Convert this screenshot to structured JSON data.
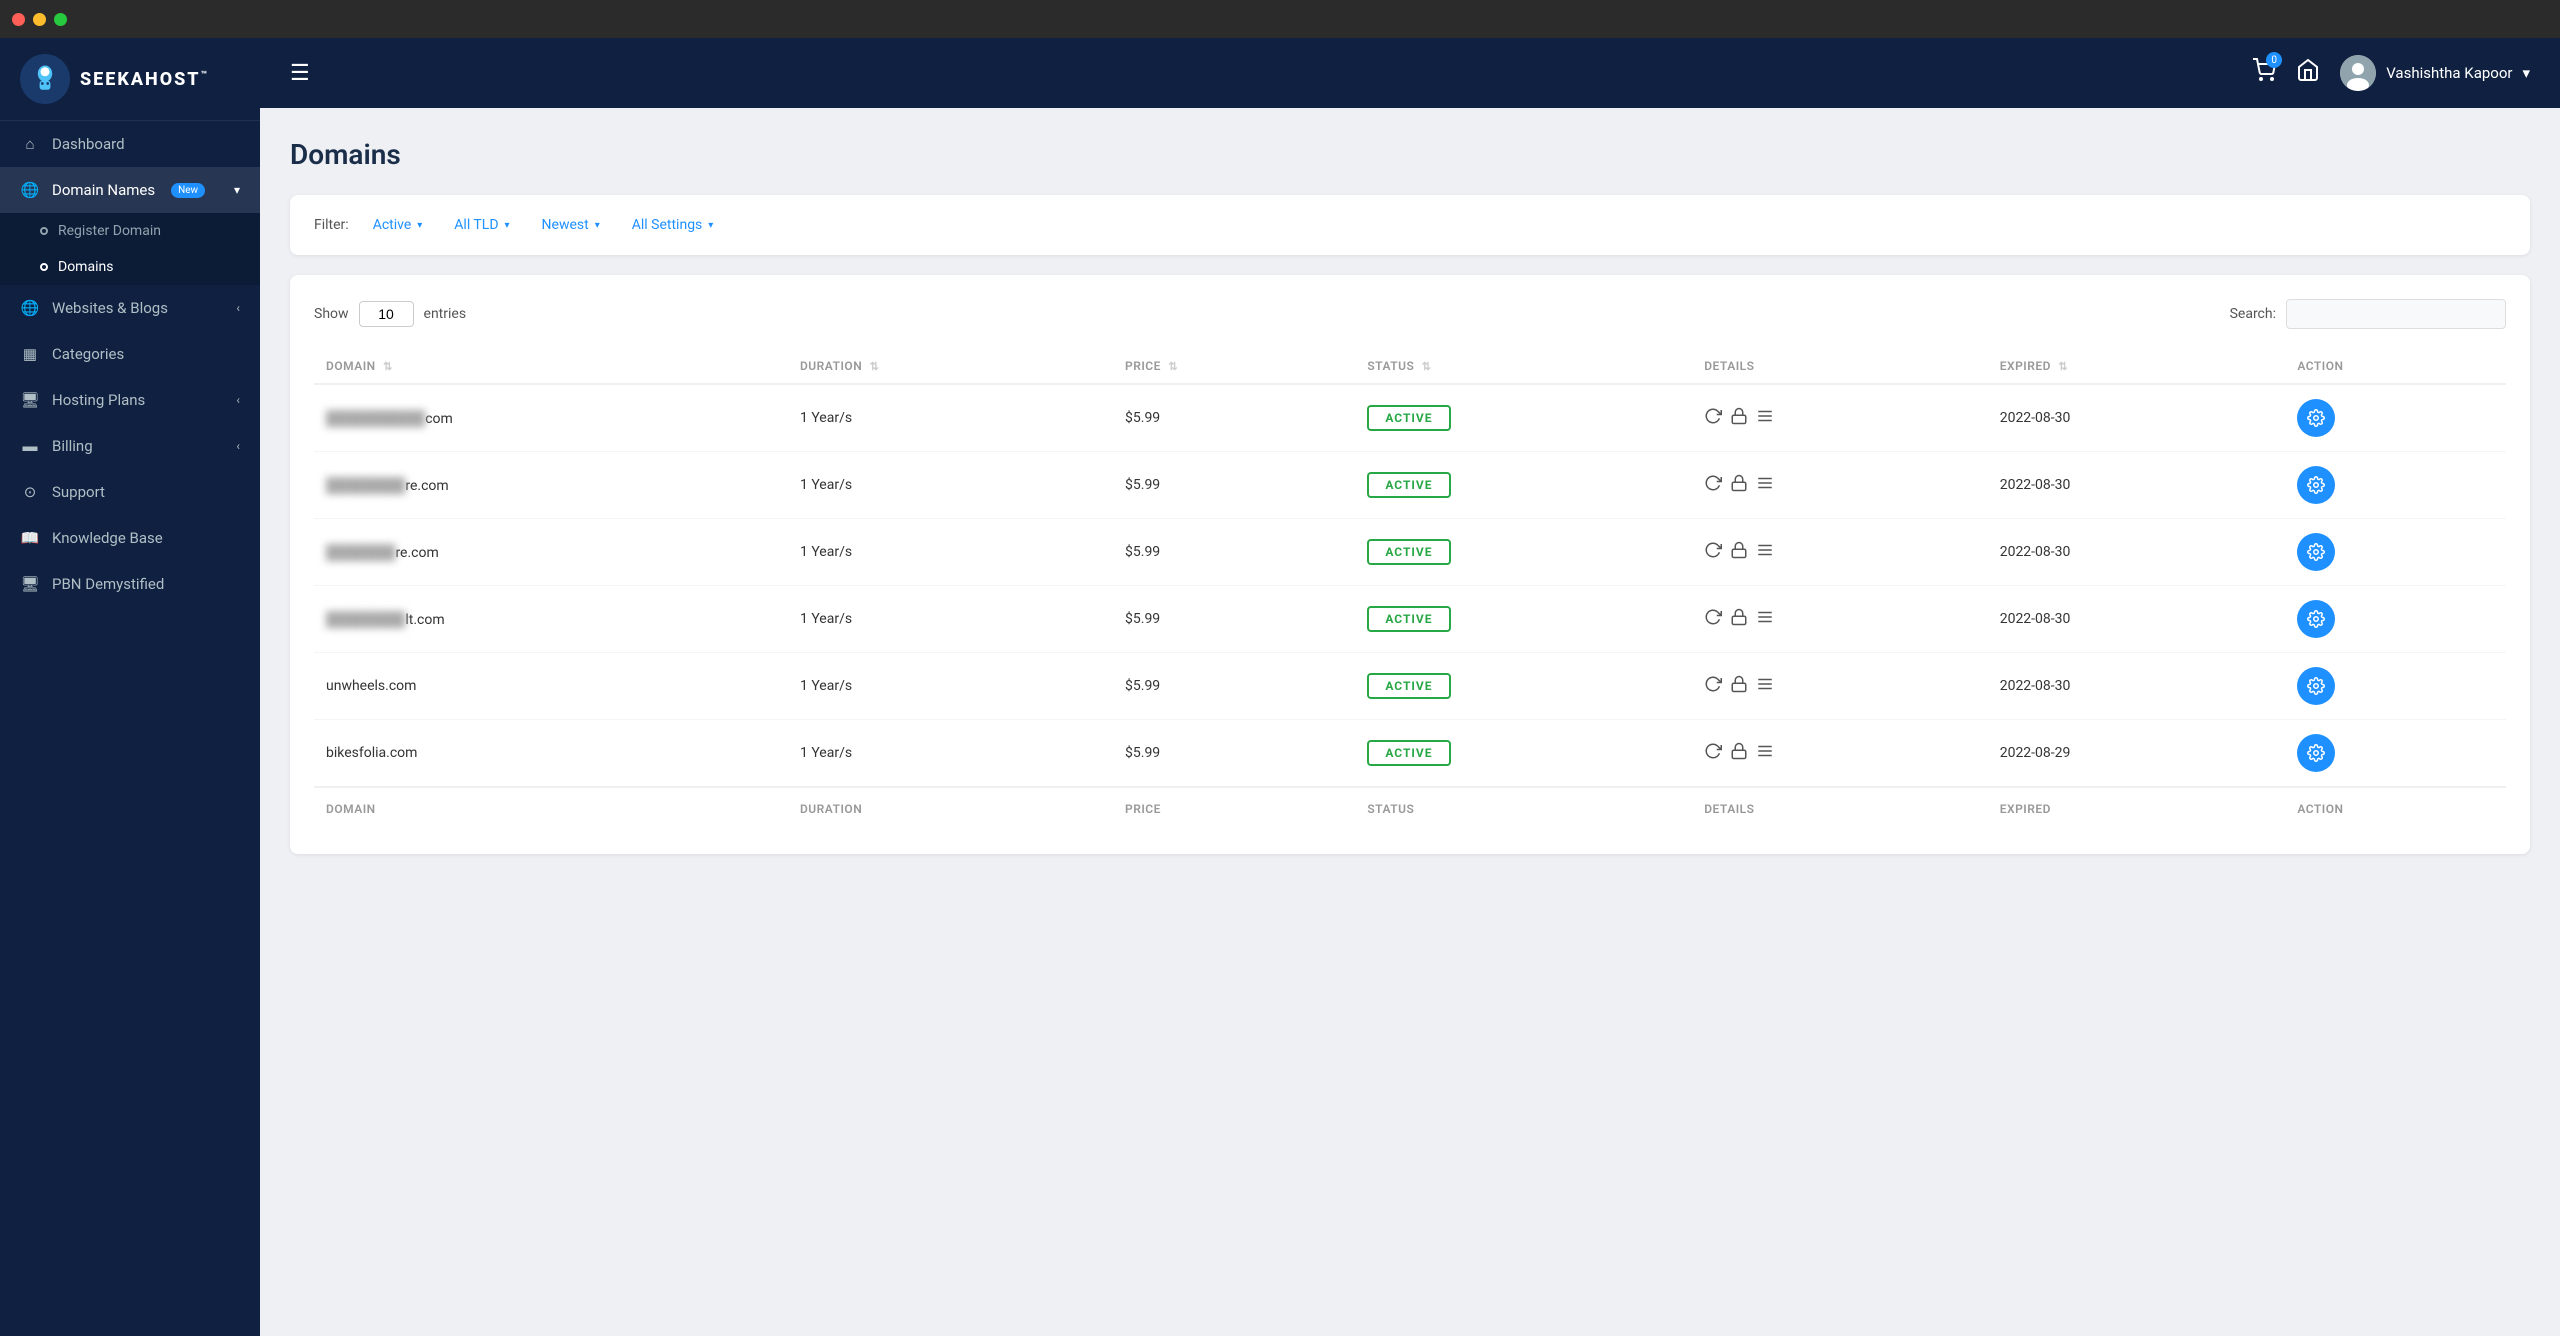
{
  "titlebar": {
    "buttons": [
      "red",
      "yellow",
      "green"
    ]
  },
  "sidebar": {
    "logo": {
      "alt": "SeekaHost",
      "text": "SEEKAHOST",
      "tm": "™"
    },
    "nav": [
      {
        "id": "dashboard",
        "icon": "home",
        "label": "Dashboard",
        "active": false
      },
      {
        "id": "domain-names",
        "icon": "globe",
        "label": "Domain Names",
        "badge": "New",
        "hasChevron": true,
        "active": true
      },
      {
        "id": "websites-blogs",
        "icon": "globe2",
        "label": "Websites & Blogs",
        "hasChevron": true,
        "active": false
      },
      {
        "id": "categories",
        "icon": "categories",
        "label": "Categories",
        "active": false
      },
      {
        "id": "hosting-plans",
        "icon": "server",
        "label": "Hosting Plans",
        "hasChevron": true,
        "active": false
      },
      {
        "id": "billing",
        "icon": "billing",
        "label": "Billing",
        "hasChevron": true,
        "active": false
      },
      {
        "id": "support",
        "icon": "support",
        "label": "Support",
        "active": false
      },
      {
        "id": "knowledge-base",
        "icon": "book",
        "label": "Knowledge Base",
        "active": false
      },
      {
        "id": "pbn",
        "icon": "monitor",
        "label": "PBN Demystified",
        "active": false
      }
    ],
    "subnav": [
      {
        "id": "register-domain",
        "label": "Register Domain",
        "active": false
      },
      {
        "id": "domains",
        "label": "Domains",
        "active": true
      }
    ]
  },
  "topbar": {
    "hamburger": "☰",
    "cart_count": "0",
    "user_name": "Vashishtha Kapoor",
    "user_chevron": "▾"
  },
  "page": {
    "title": "Domains"
  },
  "filters": {
    "label": "Filter:",
    "active": {
      "label": "Active",
      "caret": "▾"
    },
    "tld": {
      "label": "All TLD",
      "caret": "▾"
    },
    "newest": {
      "label": "Newest",
      "caret": "▾"
    },
    "settings": {
      "label": "All Settings",
      "caret": "▾"
    }
  },
  "table": {
    "show_label": "Show",
    "entries_label": "entries",
    "entries_value": "10",
    "search_label": "Search:",
    "search_placeholder": "",
    "columns": [
      "DOMAIN",
      "DURATION",
      "PRICE",
      "STATUS",
      "DETAILS",
      "EXPIRED",
      "ACTION"
    ],
    "rows": [
      {
        "domain": "com",
        "domain_blurred": "██████████",
        "duration": "1 Year/s",
        "price": "$5.99",
        "status": "ACTIVE",
        "expired": "2022-08-30"
      },
      {
        "domain": "re.com",
        "domain_blurred": "████████",
        "duration": "1 Year/s",
        "price": "$5.99",
        "status": "ACTIVE",
        "expired": "2022-08-30"
      },
      {
        "domain": "re.com",
        "domain_blurred": "███████",
        "duration": "1 Year/s",
        "price": "$5.99",
        "status": "ACTIVE",
        "expired": "2022-08-30"
      },
      {
        "domain": "lt.com",
        "domain_blurred": "████████",
        "duration": "1 Year/s",
        "price": "$5.99",
        "status": "ACTIVE",
        "expired": "2022-08-30"
      },
      {
        "domain": "unwheels.com",
        "domain_blurred": "",
        "duration": "1 Year/s",
        "price": "$5.99",
        "status": "ACTIVE",
        "expired": "2022-08-30"
      },
      {
        "domain": "bikesfolia.com",
        "domain_blurred": "",
        "duration": "1 Year/s",
        "price": "$5.99",
        "status": "ACTIVE",
        "expired": "2022-08-29"
      }
    ]
  }
}
